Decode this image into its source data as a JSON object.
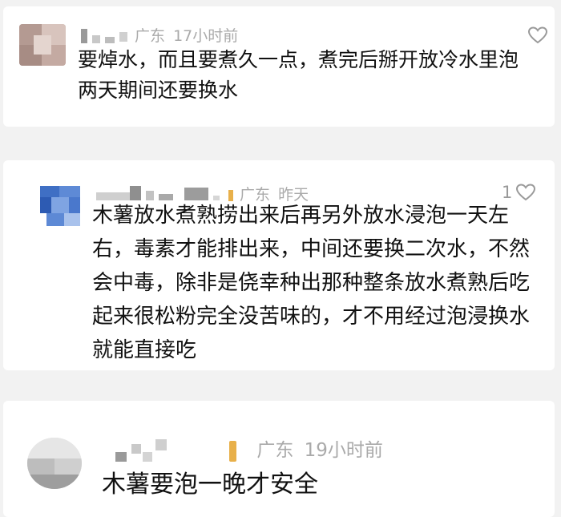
{
  "comments": [
    {
      "location": "广东",
      "time": "17小时前",
      "likes": "",
      "text": "要焯水，而且要煮久一点，煮完后掰开放冷水里泡两天期间还要换水"
    },
    {
      "location": "广东",
      "time": "昨天",
      "likes": "1",
      "text": "木薯放水煮熟捞出来后再另外放水浸泡一天左右，毒素才能排出来，中间还要换二次水，不然会中毒，除非是侥幸种出那种整条放水煮熟后吃起来很松粉完全没苦味的，才不用经过泡浸换水就能直接吃"
    },
    {
      "location": "广东",
      "time": "19小时前",
      "likes": "",
      "text": "木薯要泡一晚才安全"
    }
  ],
  "icons": {
    "like": "heart-outline-icon"
  },
  "colors": {
    "background": "#f2f2f2",
    "card": "#ffffff",
    "text": "#111111",
    "meta": "#aaaaaa",
    "location_mark": "#e8b04a"
  }
}
